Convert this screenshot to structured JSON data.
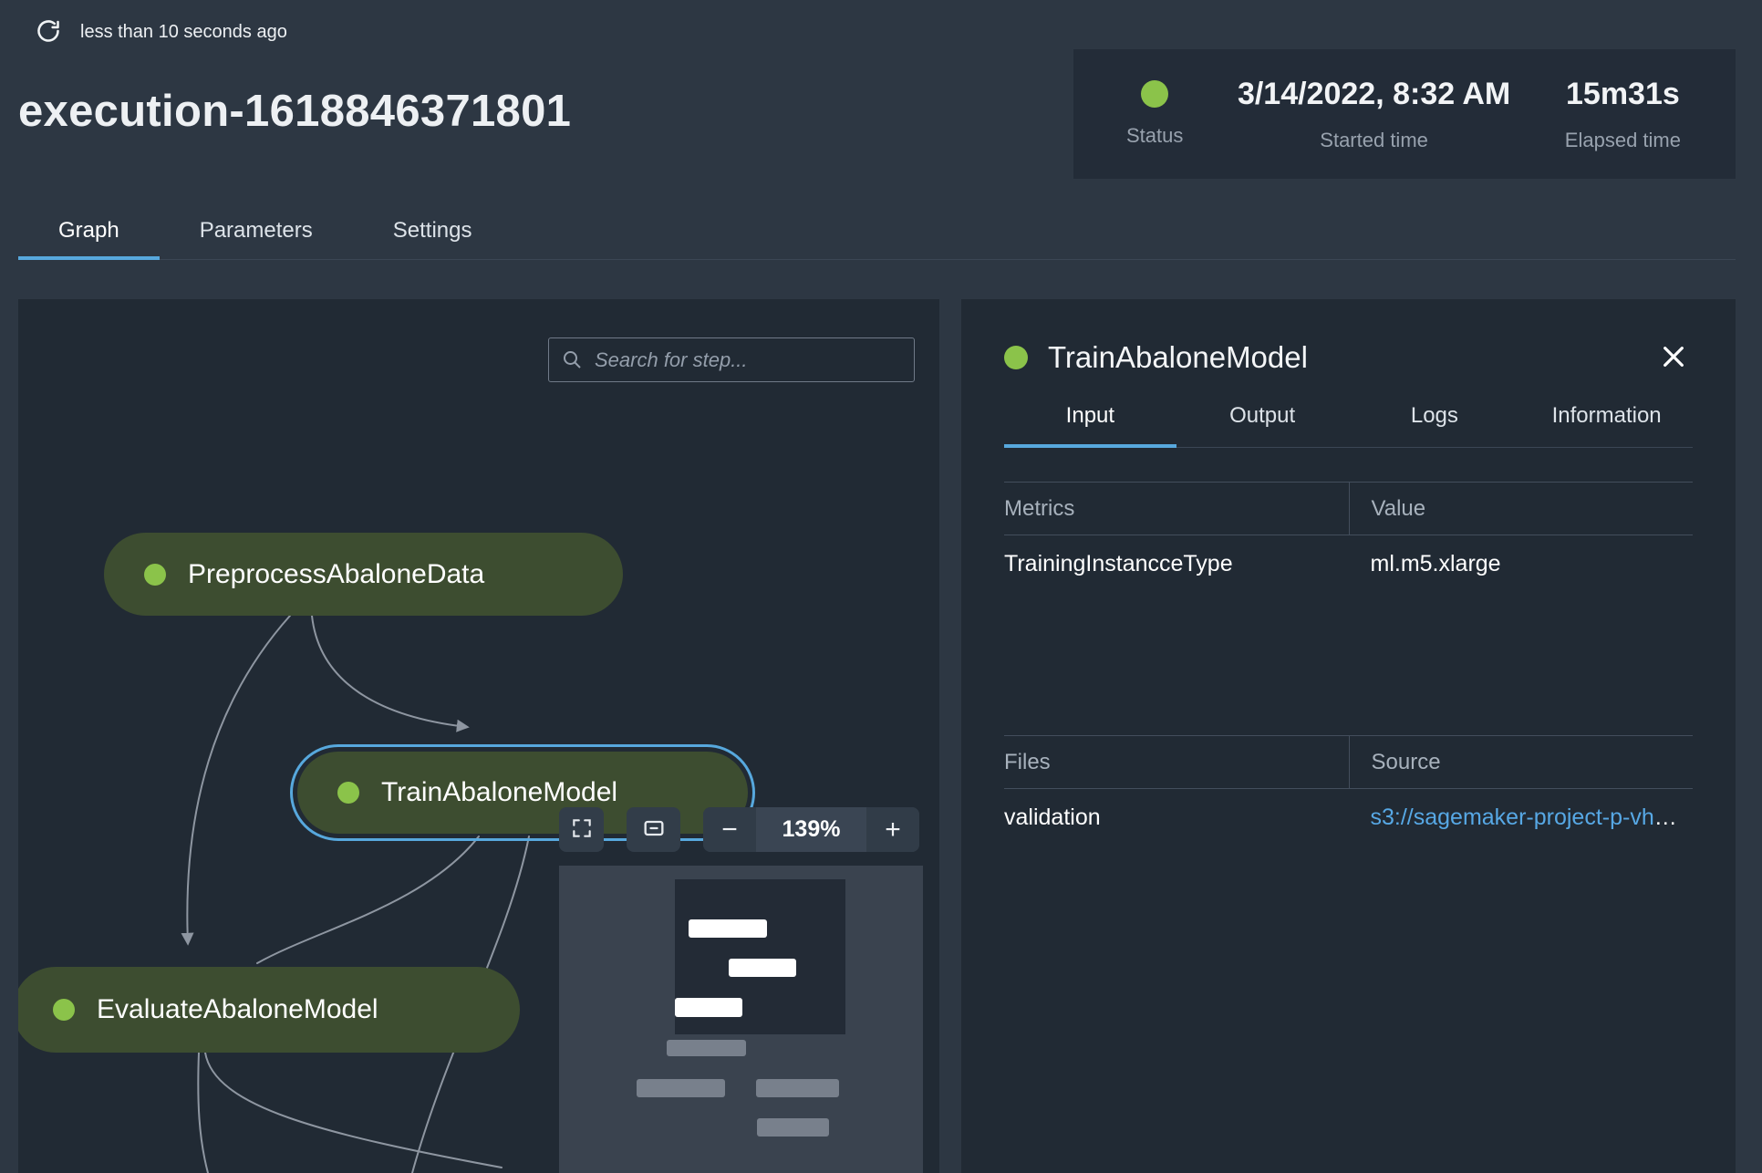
{
  "colors": {
    "page_bg": "#2d3743",
    "panel_bg": "#212a34",
    "card_bg": "#232c38",
    "accent_blue": "#57a8dd",
    "success_green": "#8bc34a",
    "node_bg": "#3d4d30",
    "link_blue": "#57a8e5",
    "muted_text": "#98a2ae",
    "border_gray": "#434e5c",
    "edge_gray": "#9aa2ad"
  },
  "header": {
    "last_refreshed": "less than 10 seconds ago",
    "title": "execution-1618846371801"
  },
  "status_card": {
    "status_label": "Status",
    "started_value": "3/14/2022, 8:32 AM",
    "started_label": "Started time",
    "elapsed_value": "15m31s",
    "elapsed_label": "Elapsed time"
  },
  "tabs": [
    {
      "label": "Graph"
    },
    {
      "label": "Parameters"
    },
    {
      "label": "Settings"
    }
  ],
  "graph": {
    "search_placeholder": "Search for step...",
    "zoom_level": "139%",
    "zoom_out": "−",
    "zoom_in": "+",
    "nodes": [
      {
        "label": "PreprocessAbaloneData"
      },
      {
        "label": "TrainAbaloneModel",
        "selected": true
      },
      {
        "label": "EvaluateAbaloneModel"
      }
    ]
  },
  "detail": {
    "title": "TrainAbaloneModel",
    "tabs": [
      {
        "label": "Input"
      },
      {
        "label": "Output"
      },
      {
        "label": "Logs"
      },
      {
        "label": "Information"
      }
    ],
    "metrics_table": {
      "headers": [
        "Metrics",
        "Value"
      ],
      "rows": [
        [
          "TrainingInstancceType",
          "ml.m5.xlarge"
        ]
      ]
    },
    "files_table": {
      "headers": [
        "Files",
        "Source"
      ],
      "rows": [
        [
          "validation",
          "s3://sagemaker-project-p-vhcz..."
        ]
      ]
    }
  }
}
